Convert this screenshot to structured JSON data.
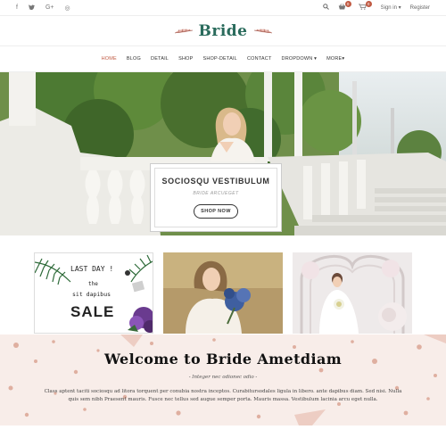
{
  "topbar": {
    "socials": [
      {
        "icon": "facebook-icon",
        "glyph": "f"
      },
      {
        "icon": "twitter-icon",
        "glyph": "t"
      },
      {
        "icon": "google-plus-icon",
        "glyph": "G+"
      },
      {
        "icon": "instagram-icon",
        "glyph": "◎"
      }
    ],
    "wishlist_count": "0",
    "cart_count": "0",
    "signin": "Sign in ▾",
    "register": "Register"
  },
  "logo": {
    "text": "Bride"
  },
  "nav": {
    "items": [
      "Home",
      "Blog",
      "Detail",
      "Shop",
      "Shop-Detail",
      "Contact",
      "Dropdown ▾",
      "More▾"
    ]
  },
  "hero": {
    "title": "SOCIOSQU VESTIBULUM",
    "subtitle": "BRIDE ARCUEGET",
    "button": "SHOP NOW"
  },
  "banners": {
    "promo": {
      "line1": "LAST DAY !",
      "line2": "the",
      "line3": "sit dapibus",
      "line4": "SALE"
    }
  },
  "welcome": {
    "title": "Welcome to Bride Ametdiam",
    "subtitle": "- Integer nec odionec odio -",
    "body": "Class aptent taciti sociosqu ad litora torquent per conubia nostra inceptos. Curabitursodales ligula in libero. ante dapibus diam. Sed nisi. Nulla quis sem nibh Praesent mauris. Fusce nec tellus sed augue semper porta. Mauris massa. Vestibulum lacinia arcu eget nulla."
  },
  "colors": {
    "accent": "#c05a43",
    "logo_green": "#2a6b5c",
    "welcome_bg": "#f8ede9"
  }
}
